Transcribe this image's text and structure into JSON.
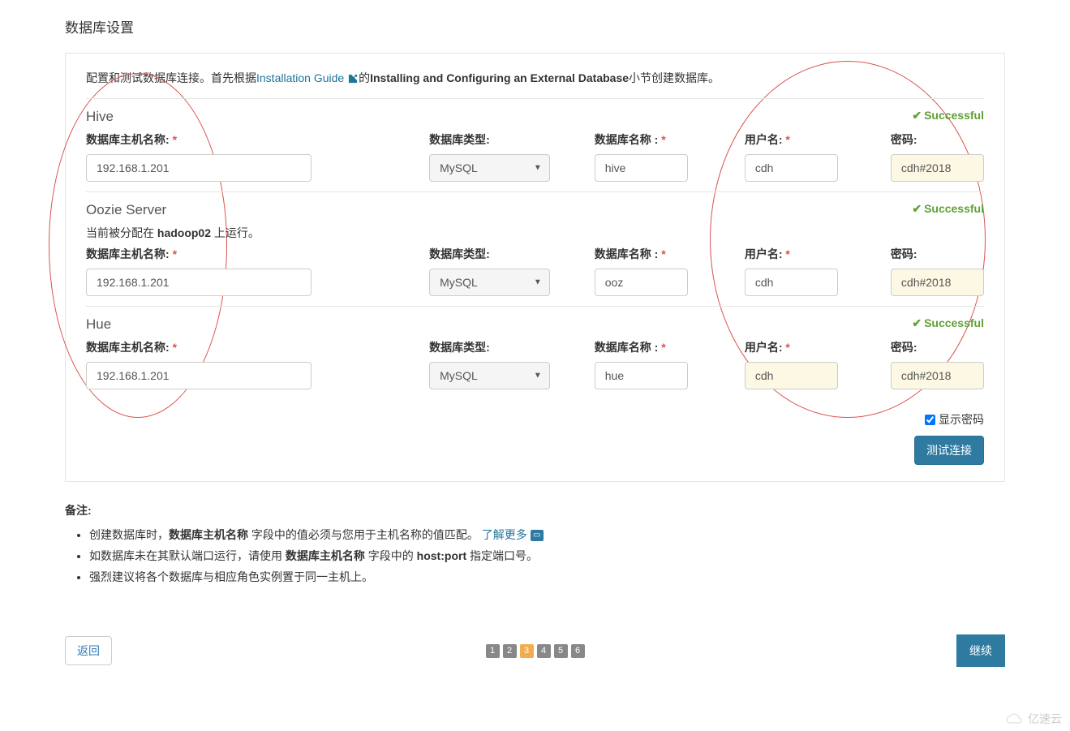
{
  "page_title": "数据库设置",
  "intro": {
    "prefix": "配置和测试数据库连接。首先根据",
    "link_text": "Installation Guide",
    "middle": "的",
    "bold_text": "Installing and Configuring an External Database",
    "suffix": "小节创建数据库。"
  },
  "labels": {
    "host": "数据库主机名称:",
    "type": "数据库类型:",
    "name": "数据库名称 :",
    "user": "用户名:",
    "pass": "密码:",
    "required": "*",
    "successful": "Successful",
    "show_password": "显示密码",
    "test_connection": "测试连接"
  },
  "sections": [
    {
      "title": "Hive",
      "host": "192.168.1.201",
      "type": "MySQL",
      "name": "hive",
      "user": "cdh",
      "pass": "cdh#2018",
      "highlight_user": false,
      "highlight_pass": true
    },
    {
      "title": "Oozie Server",
      "note_prefix": "当前被分配在 ",
      "note_bold": "hadoop02",
      "note_suffix": " 上运行。",
      "host": "192.168.1.201",
      "type": "MySQL",
      "name": "ooz",
      "user": "cdh",
      "pass": "cdh#2018",
      "highlight_user": false,
      "highlight_pass": true
    },
    {
      "title": "Hue",
      "host": "192.168.1.201",
      "type": "MySQL",
      "name": "hue",
      "user": "cdh",
      "pass": "cdh#2018",
      "highlight_user": true,
      "highlight_pass": true
    }
  ],
  "notes": {
    "title": "备注:",
    "items": [
      {
        "prefix": "创建数据库时，",
        "bold1": "数据库主机名称",
        "middle": " 字段中的值必须与您用于主机名称的值匹配。 ",
        "link": "了解更多",
        "has_icon": true
      },
      {
        "prefix": "如数据库未在其默认端口运行，请使用 ",
        "bold1": "数据库主机名称",
        "middle": " 字段中的 ",
        "bold2": "host:port",
        "suffix": " 指定端口号。"
      },
      {
        "prefix": "强烈建议将各个数据库与相应角色实例置于同一主机上。"
      }
    ]
  },
  "footer": {
    "back": "返回",
    "continue": "继续",
    "steps": [
      "1",
      "2",
      "3",
      "4",
      "5",
      "6"
    ],
    "active_step": 3
  },
  "watermark": "亿速云"
}
